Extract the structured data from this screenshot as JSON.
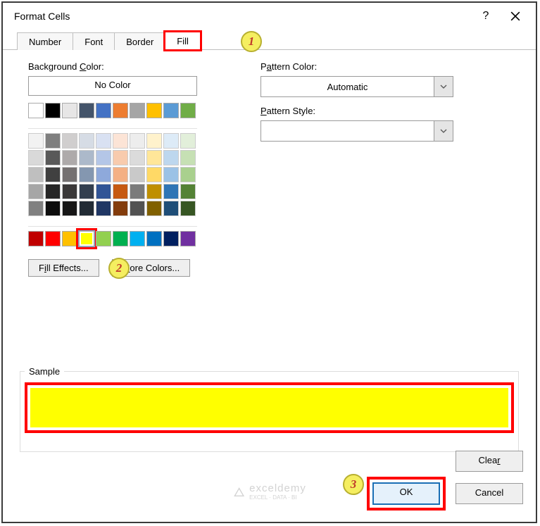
{
  "title": "Format Cells",
  "tabs": {
    "number": "Number",
    "font": "Font",
    "border": "Border",
    "fill": "Fill"
  },
  "bgColor": {
    "label": "Background Color:",
    "noColor": "No Color"
  },
  "themeRow": [
    "#ffffff",
    "#000000",
    "#e7e6e6",
    "#44546a",
    "#4472c4",
    "#ed7d31",
    "#a5a5a5",
    "#ffc000",
    "#5b9bd5",
    "#70ad47"
  ],
  "themeShades": [
    [
      "#f2f2f2",
      "#7f7f7f",
      "#d0cece",
      "#d6dce5",
      "#d9e1f2",
      "#fce4d6",
      "#ededed",
      "#fff2cc",
      "#ddebf7",
      "#e2efda"
    ],
    [
      "#d9d9d9",
      "#595959",
      "#aeaaaa",
      "#acb9ca",
      "#b4c6e7",
      "#f8cbad",
      "#dbdbdb",
      "#ffe699",
      "#bdd7ee",
      "#c6e0b4"
    ],
    [
      "#bfbfbf",
      "#404040",
      "#757171",
      "#8497b0",
      "#8ea9db",
      "#f4b084",
      "#c9c9c9",
      "#ffd966",
      "#9bc2e6",
      "#a9d08e"
    ],
    [
      "#a6a6a6",
      "#262626",
      "#3a3838",
      "#333f4f",
      "#305496",
      "#c65911",
      "#7b7b7b",
      "#bf8f00",
      "#2f75b5",
      "#548235"
    ],
    [
      "#808080",
      "#0d0d0d",
      "#161616",
      "#222b35",
      "#203764",
      "#833c0c",
      "#525252",
      "#806000",
      "#1f4e78",
      "#375623"
    ]
  ],
  "standard": [
    "#c00000",
    "#ff0000",
    "#ffc000",
    "#ffff00",
    "#92d050",
    "#00b050",
    "#00b0f0",
    "#0070c0",
    "#002060",
    "#7030a0"
  ],
  "buttons": {
    "fillEffects": "Fill Effects...",
    "moreColors": "More Colors...",
    "ok": "OK",
    "cancel": "Cancel",
    "clear": "Clear"
  },
  "pattern": {
    "colorLabel": "Pattern Color:",
    "colorValue": "Automatic",
    "styleLabel": "Pattern Style:",
    "styleValue": ""
  },
  "sample": {
    "label": "Sample"
  },
  "anno": {
    "one": "1",
    "two": "2",
    "three": "3"
  },
  "watermark": {
    "brand": "exceldemy",
    "sub": "EXCEL · DATA · BI"
  }
}
